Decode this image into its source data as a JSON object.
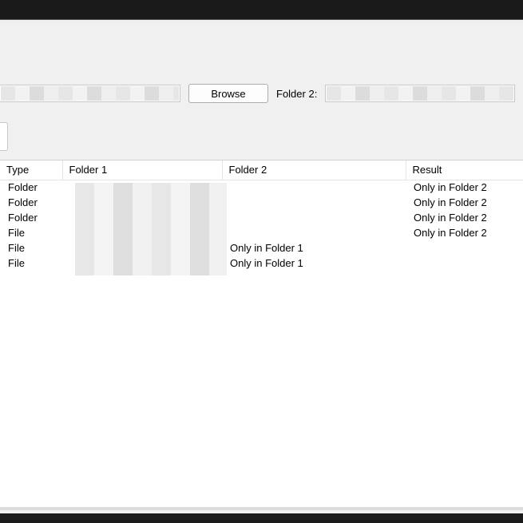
{
  "toolbar": {
    "browse_label": "Browse",
    "folder2_label": "Folder 2:"
  },
  "columns": {
    "type": "Type",
    "folder1": "Folder 1",
    "folder2": "Folder 2",
    "result": "Result"
  },
  "rows": [
    {
      "type": "Folder",
      "folder1": "",
      "folder2": "",
      "result": "Only in Folder 2"
    },
    {
      "type": "Folder",
      "folder1": "",
      "folder2": "",
      "result": "Only in Folder 2"
    },
    {
      "type": "Folder",
      "folder1": "",
      "folder2": "",
      "result": "Only in Folder 2"
    },
    {
      "type": "File",
      "folder1": "",
      "folder2": "",
      "result": "Only in Folder 2"
    },
    {
      "type": "File",
      "folder1": "",
      "folder2": "Only in Folder 1",
      "result": ""
    },
    {
      "type": "File",
      "folder1": "",
      "folder2": "Only in Folder 1",
      "result": ""
    }
  ]
}
